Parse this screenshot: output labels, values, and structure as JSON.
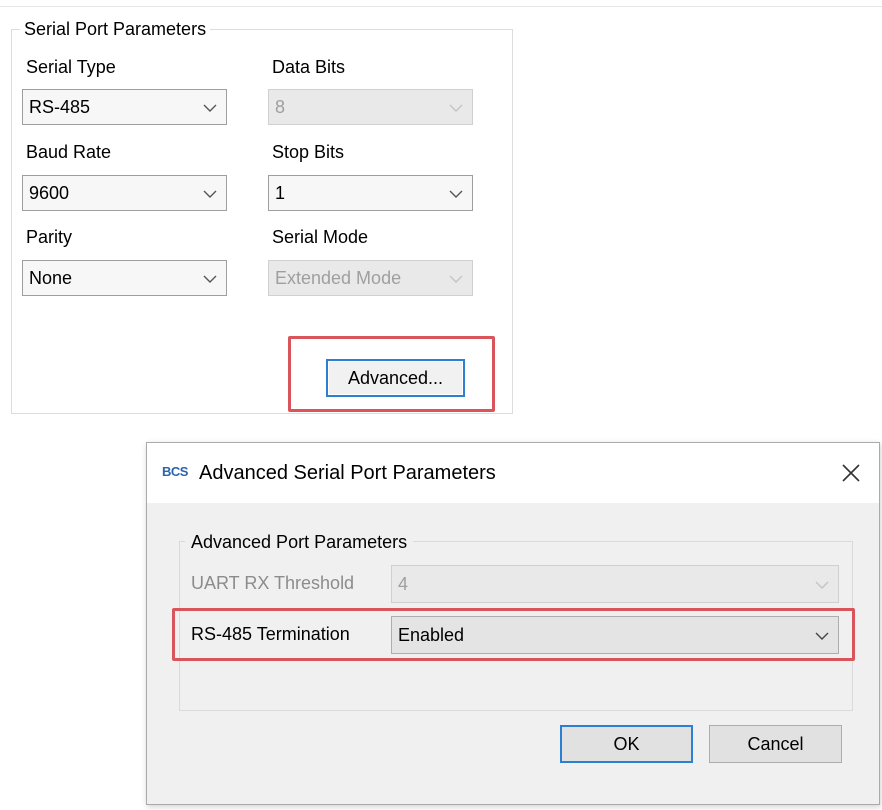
{
  "serial_port": {
    "group_title": "Serial Port Parameters",
    "serial_type": {
      "label": "Serial Type",
      "value": "RS-485"
    },
    "data_bits": {
      "label": "Data Bits",
      "value": "8"
    },
    "baud_rate": {
      "label": "Baud Rate",
      "value": "9600"
    },
    "stop_bits": {
      "label": "Stop Bits",
      "value": "1"
    },
    "parity": {
      "label": "Parity",
      "value": "None"
    },
    "serial_mode": {
      "label": "Serial Mode",
      "value": "Extended Mode"
    },
    "advanced_button": "Advanced..."
  },
  "dialog": {
    "app_icon_text": "BCS",
    "title": "Advanced Serial Port Parameters",
    "group_title": "Advanced Port Parameters",
    "uart_rx_threshold": {
      "label": "UART RX Threshold",
      "value": "4"
    },
    "rs485_termination": {
      "label": "RS-485 Termination",
      "value": "Enabled"
    },
    "ok_button": "OK",
    "cancel_button": "Cancel"
  },
  "colors": {
    "highlight": "#d9545b",
    "focus_border": "#2c7fd2",
    "app_icon": "#2a64b0"
  },
  "icons": {
    "dropdown": "chevron-down-icon",
    "close": "close-icon"
  }
}
